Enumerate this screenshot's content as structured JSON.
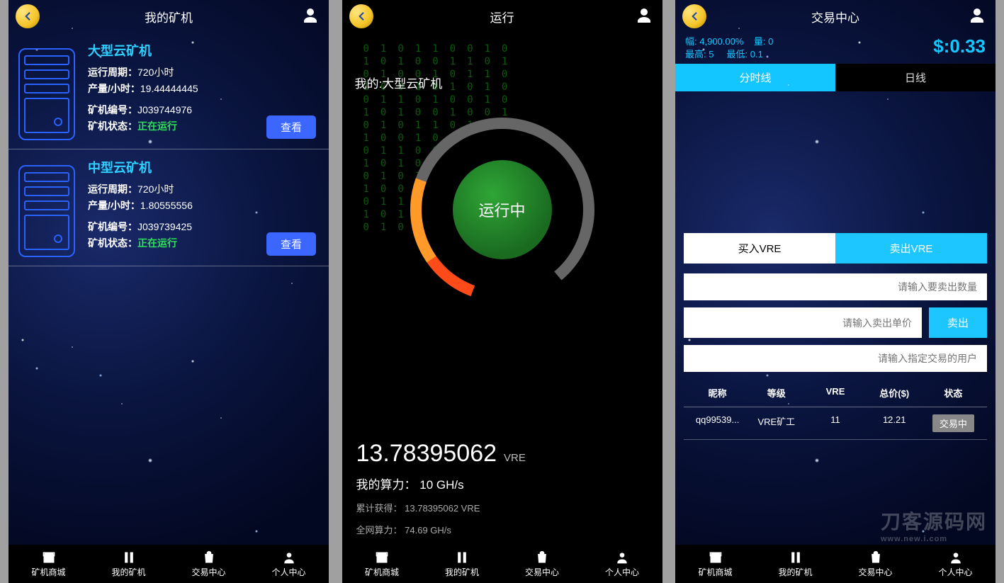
{
  "nav": {
    "items": [
      {
        "label": "矿机商城"
      },
      {
        "label": "我的矿机"
      },
      {
        "label": "交易中心"
      },
      {
        "label": "个人中心"
      }
    ]
  },
  "screen1": {
    "title": "我的矿机",
    "miners": [
      {
        "name": "大型云矿机",
        "period_label": "运行周期：",
        "period": "720小时",
        "yield_label": "产量/小时：",
        "yield": "19.44444445",
        "id_label": "矿机编号：",
        "id": "J039744976",
        "status_label": "矿机状态：",
        "status": "正在运行",
        "view": "查看"
      },
      {
        "name": "中型云矿机",
        "period_label": "运行周期：",
        "period": "720小时",
        "yield_label": "产量/小时：",
        "yield": "1.80555556",
        "id_label": "矿机编号：",
        "id": "J039739425",
        "status_label": "矿机状态：",
        "status": "正在运行",
        "view": "查看"
      }
    ]
  },
  "screen2": {
    "title": "运行",
    "mine_label_prefix": "我的:",
    "mine_name": "大型云矿机",
    "dial_status": "运行中",
    "big_value": "13.78395062",
    "big_unit": "VRE",
    "hash_label": "我的算力：",
    "hash_value": "10 GH/s",
    "total_label": "累计获得：",
    "total_value": "13.78395062 VRE",
    "net_label": "全网算力：",
    "net_value": "74.69 GH/s"
  },
  "screen3": {
    "title": "交易中心",
    "ticker": {
      "chg_label": "幅:",
      "chg": "4,900.00%",
      "vol_label": "量:",
      "vol": "0",
      "high_label": "最高:",
      "high": "5",
      "low_label": "最低:",
      "low": "0.1",
      "price": "$:0.33"
    },
    "tabs": {
      "minute": "分时线",
      "day": "日线"
    },
    "buy_label": "买入VRE",
    "sell_label": "卖出VRE",
    "qty_placeholder": "请输入要卖出数量",
    "price_placeholder": "请输入卖出单价",
    "user_placeholder": "请输入指定交易的用户",
    "submit": "卖出",
    "table": {
      "headers": [
        "昵称",
        "等级",
        "VRE",
        "总价($)",
        "状态"
      ],
      "rows": [
        {
          "nick": "qq99539...",
          "lvl": "VRE矿工",
          "vre": "11",
          "total": "12.21",
          "status": "交易中"
        }
      ]
    },
    "watermark": "刀客源码网",
    "watermark_sub": "www.new.i.com"
  }
}
